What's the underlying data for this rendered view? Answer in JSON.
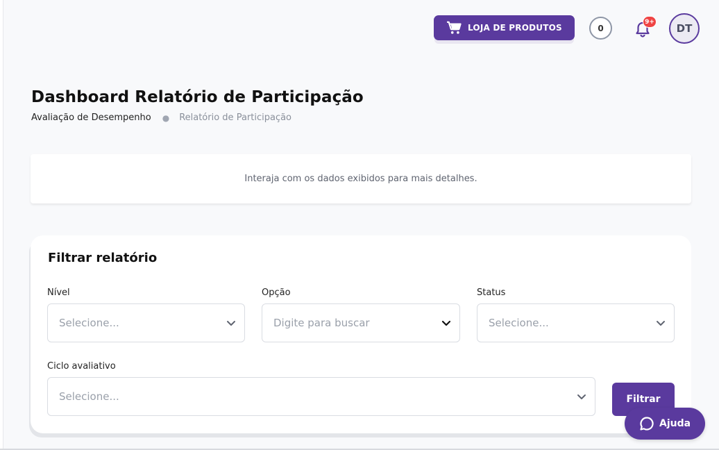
{
  "header": {
    "shop_label": "LOJA DE PRODUTOS",
    "coin_count": "0",
    "notification_badge": "9+",
    "avatar_initials": "DT"
  },
  "page": {
    "title": "Dashboard Relatório de Participação",
    "breadcrumb": [
      "Avaliação de Desempenho",
      "Relatório de Participação"
    ]
  },
  "info": {
    "text": "Interaja com os dados exibidos para mais detalhes."
  },
  "filter": {
    "title": "Filtrar relatório",
    "fields": [
      {
        "label": "Nível",
        "placeholder": "Selecione..."
      },
      {
        "label": "Opção",
        "placeholder": "Digite para buscar"
      },
      {
        "label": "Status",
        "placeholder": "Selecione..."
      },
      {
        "label": "Ciclo avaliativo",
        "placeholder": "Selecione..."
      }
    ],
    "submit_label": "Filtrar"
  },
  "help": {
    "label": "Ajuda"
  },
  "colors": {
    "brand": "#5a3a9e",
    "badge": "#ef4444",
    "background": "#f8f9fb"
  },
  "icons": [
    "cart-icon",
    "bell-icon",
    "chevron-down-icon",
    "chat-bubble-icon"
  ]
}
